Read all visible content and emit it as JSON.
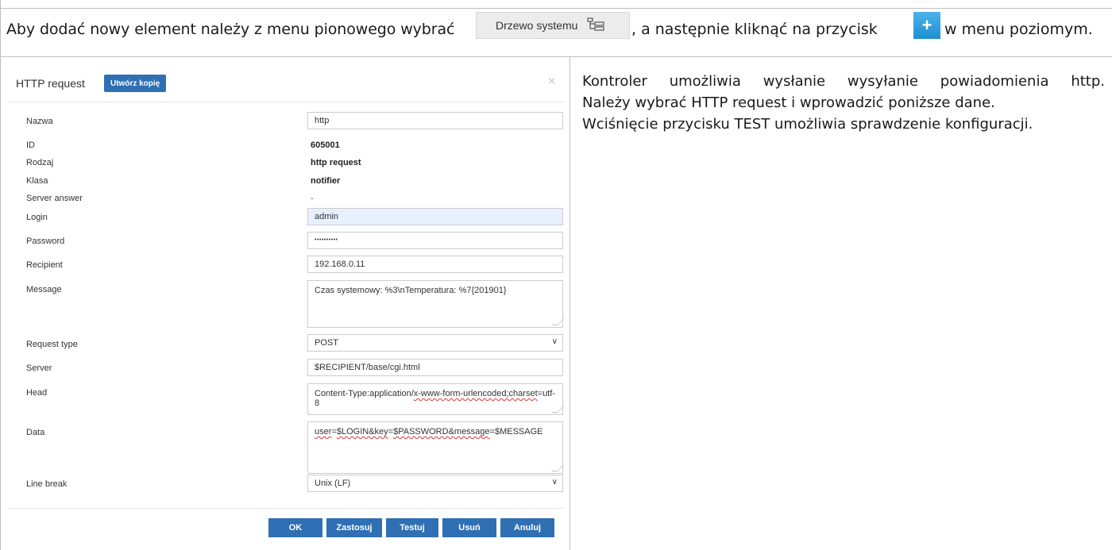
{
  "intro": {
    "part1": "Aby dodać nowy element należy z menu pionowego wybrać",
    "tree_button_label": "Drzewo systemu",
    "part2": ", a następnie kliknąć na przycisk",
    "part3": "w menu poziomym."
  },
  "dialog": {
    "title": "HTTP request",
    "copy_button": "Utwórz kopię",
    "close": "×",
    "fields": {
      "nazwa": {
        "label": "Nazwa",
        "value": "http"
      },
      "id": {
        "label": "ID",
        "value": "605001"
      },
      "rodzaj": {
        "label": "Rodzaj",
        "value": "http request"
      },
      "klasa": {
        "label": "Klasa",
        "value": "notifier"
      },
      "server_answer": {
        "label": "Server answer",
        "value": "-"
      },
      "login": {
        "label": "Login",
        "value": "admin"
      },
      "password": {
        "label": "Password",
        "value": "••••••••••"
      },
      "recipient": {
        "label": "Recipient",
        "value": "192.168.0.11"
      },
      "message": {
        "label": "Message",
        "value": "Czas systemowy: %3\\nTemperatura: %7{201901}"
      },
      "request_type": {
        "label": "Request type",
        "value": "POST"
      },
      "server": {
        "label": "Server",
        "value": "$RECIPIENT/base/cgi.html"
      },
      "head": {
        "label": "Head",
        "value_a": "Content-Type:application/",
        "value_b": "x-www-form-urlencoded;charset",
        "value_c": "=utf-8"
      },
      "data": {
        "label": "Data",
        "value_a": "user",
        "value_b": "=",
        "value_c": "$LOGIN&key",
        "value_d": "=",
        "value_e": "$PASSWORD&message",
        "value_f": "=$MESSAGE"
      },
      "line_break": {
        "label": "Line break",
        "value": "Unix (LF)"
      }
    },
    "buttons": {
      "ok": "OK",
      "apply": "Zastosuj",
      "test": "Testuj",
      "delete": "Usuń",
      "cancel": "Anuluj"
    }
  },
  "description": {
    "line1": "Kontroler umożliwia wysłanie wysyłanie powiadomienia http.",
    "line2": "Należy wybrać HTTP request i wprowadzić poniższe dane.",
    "line3": "Wciśnięcie przycisku TEST umożliwia sprawdzenie konfiguracji."
  }
}
